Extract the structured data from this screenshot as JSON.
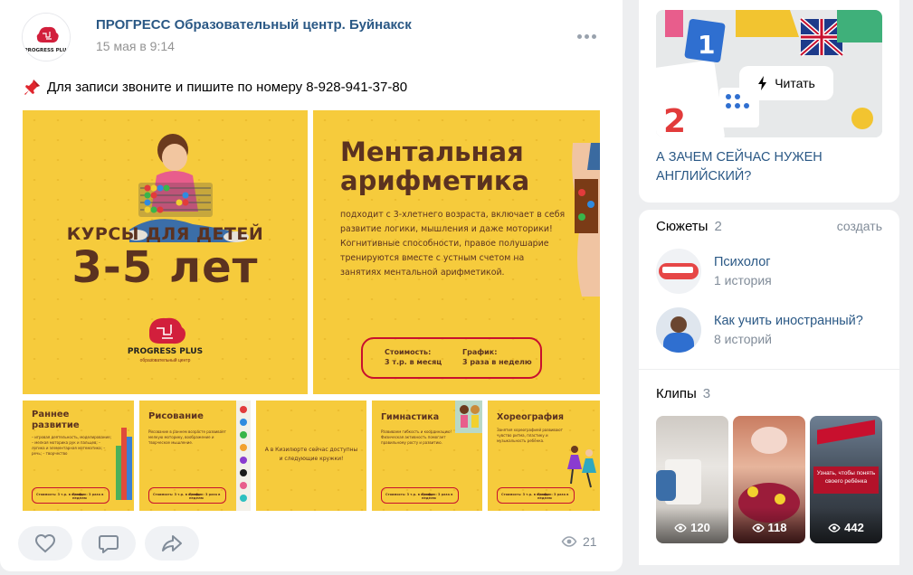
{
  "post": {
    "author": "ПРОГРЕСС Образовательный центр. Буйнакск",
    "date": "15 мая в 9:14",
    "text": "Для записи звоните и пишите по номеру 8-928-941-37-80",
    "avatar_logo_text": "PROGRESS PLUS",
    "images": {
      "main": {
        "title_line1": "КУРСЫ ДЛЯ ДЕТЕЙ",
        "title_line2": "3-5 лет",
        "logo_text": "PROGRESS PLUS",
        "logo_sub": "образовательный центр"
      },
      "mental": {
        "title_line1": "Ментальная",
        "title_line2": "арифметика",
        "body": "подходит с 3-хлетнего возраста, включает в себя развитие логики, мышления и даже моторики! Когнитивные способности, правое полушарие тренируются вместе с устным счетом на занятиях ментальной арифметикой.",
        "price_label": "Стоимость:",
        "price_value": "3 т.р. в месяц",
        "schedule_label": "График:",
        "schedule_value": "3 раза в неделю"
      },
      "thumbs": [
        {
          "title": "Раннее развитие",
          "body": "– игровая деятельность, моделирование; – мелкая моторика рук и пальцев; – логика и элементарная математика; – речь; – творчество",
          "price": "Стоимость: 3 т.р. в месяц",
          "schedule": "График: 3 раза в неделю"
        },
        {
          "title": "Рисование",
          "body": "Рисование в раннем возрасте развивает мелкую моторику, воображение и творческое мышление.",
          "price": "Стоимость: 3 т.р. в месяц",
          "schedule": "График: 3 раза в неделю"
        },
        {
          "title": "",
          "body": "А в Кизилюрте сейчас доступны и следующие кружки!",
          "price": "",
          "schedule": ""
        },
        {
          "title": "Гимнастика",
          "body": "Развиваем гибкость и координацию! Физическая активность помогает правильному росту и развитию.",
          "price": "Стоимость: 3 т.р. в месяц",
          "schedule": "График: 3 раза в неделю"
        },
        {
          "title": "Хореография",
          "body": "Занятия хореографией развивают чувство ритма, пластику и музыкальность ребёнка.",
          "price": "Стоимость: 3 т.р. в месяц",
          "schedule": "График: 3 раза в неделю"
        }
      ]
    },
    "views": "21"
  },
  "sidebar": {
    "article": {
      "read_button": "Читать",
      "title": "А ЗАЧЕМ СЕЙЧАС НУЖЕН АНГЛИЙСКИЙ?"
    },
    "stories": {
      "title": "Сюжеты",
      "count": "2",
      "create": "создать",
      "items": [
        {
          "name": "Психолог",
          "sub": "1 история"
        },
        {
          "name": "Как учить иностранный?",
          "sub": "8 историй"
        }
      ]
    },
    "clips": {
      "title": "Клипы",
      "count": "3",
      "items": [
        {
          "views": "120"
        },
        {
          "views": "118"
        },
        {
          "views": "442",
          "overlay": "Узнать, чтобы понять своего ребёнка"
        }
      ]
    }
  },
  "colors": {
    "link": "#2a5885",
    "yellow": "#f6cb3c",
    "brown": "#5b3220",
    "red": "#c8102e"
  },
  "icons": [
    "pushpin-icon",
    "more-icon",
    "like-icon",
    "comment-icon",
    "share-icon",
    "eye-icon",
    "lightning-icon"
  ]
}
